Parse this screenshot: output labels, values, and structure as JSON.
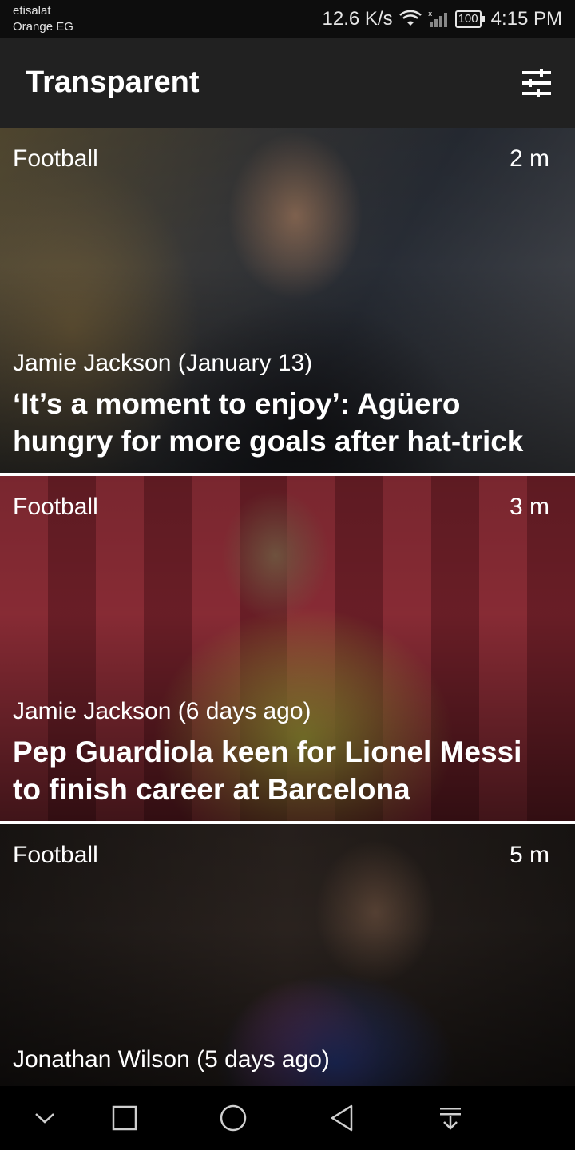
{
  "status_bar": {
    "carrier_line1": "etisalat",
    "carrier_line2": "Orange EG",
    "net_speed": "12.6 K/s",
    "battery": "100",
    "time": "4:15 PM"
  },
  "app_bar": {
    "title": "Transparent",
    "filter_icon": "tune-icon"
  },
  "articles": [
    {
      "category": "Football",
      "age": "2 m",
      "byline": "Jamie Jackson (January 13)",
      "headline": "‘It’s a moment to enjoy’: Agüero hungry for more goals after hat-trick"
    },
    {
      "category": "Football",
      "age": "3 m",
      "byline": "Jamie Jackson (6 days ago)",
      "headline": "Pep Guardiola keen for Lionel Messi to finish career at Barcelona"
    },
    {
      "category": "Football",
      "age": "5 m",
      "byline": "Jonathan Wilson (5 days ago)",
      "headline": ""
    }
  ],
  "nav_bar": {
    "icons": [
      "chevron-down-icon",
      "recent-apps-icon",
      "home-icon",
      "back-icon",
      "notification-pull-icon"
    ]
  },
  "colors": {
    "status_bar_bg": "#0d0d0d",
    "app_bar_bg": "#212121",
    "nav_bar_bg": "#000000",
    "divider": "#ffffff"
  }
}
